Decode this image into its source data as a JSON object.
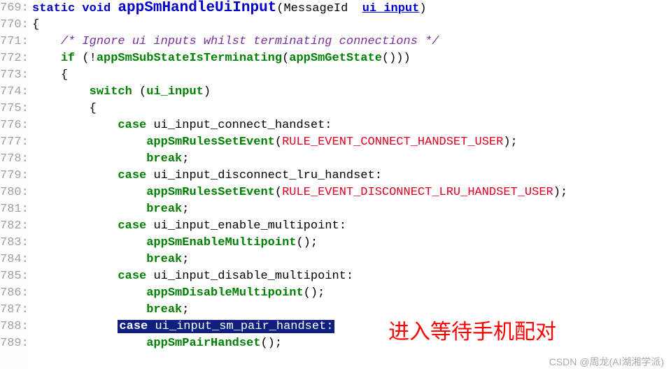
{
  "lineStart": 769,
  "lines": {
    "l769": {
      "kw_static": "static",
      "kw_void": "void",
      "func": "appSmHandleUiInput",
      "ptype": "MessageId",
      "pname": "ui_input"
    },
    "l770": {
      "brace": "{"
    },
    "l771": {
      "comment": "/* Ignore ui inputs whilst terminating connections */"
    },
    "l772": {
      "kw_if": "if",
      "f1": "appSmSubStateIsTerminating",
      "f2": "appSmGetState"
    },
    "l773": {
      "brace": "{"
    },
    "l774": {
      "kw_switch": "switch",
      "var": "ui_input"
    },
    "l775": {
      "brace": "{"
    },
    "l776": {
      "kw_case": "case",
      "label": "ui_input_connect_handset"
    },
    "l777": {
      "func": "appSmRulesSetEvent",
      "arg": "RULE_EVENT_CONNECT_HANDSET_USER"
    },
    "l778": {
      "kw_break": "break"
    },
    "l779": {
      "kw_case": "case",
      "label": "ui_input_disconnect_lru_handset"
    },
    "l780": {
      "func": "appSmRulesSetEvent",
      "arg": "RULE_EVENT_DISCONNECT_LRU_HANDSET_USER"
    },
    "l781": {
      "kw_break": "break"
    },
    "l782": {
      "kw_case": "case",
      "label": "ui_input_enable_multipoint"
    },
    "l783": {
      "func": "appSmEnableMultipoint"
    },
    "l784": {
      "kw_break": "break"
    },
    "l785": {
      "kw_case": "case",
      "label": "ui_input_disable_multipoint"
    },
    "l786": {
      "func": "appSmDisableMultipoint"
    },
    "l787": {
      "kw_break": "break"
    },
    "l788": {
      "kw_case": "case",
      "label": "ui_input_sm_pair_handset"
    },
    "l789": {
      "func": "appSmPairHandset"
    }
  },
  "annotation": "进入等待手机配对",
  "watermark": "CSDN @周龙(AI湖湘学派)"
}
